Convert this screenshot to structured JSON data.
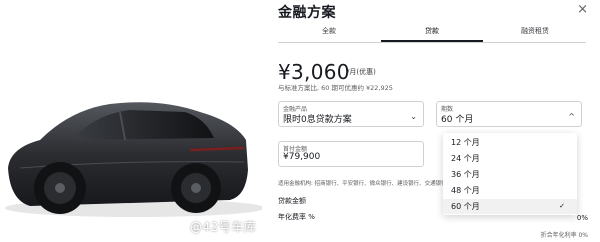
{
  "modal": {
    "title": "金融方案",
    "close_glyph": "×"
  },
  "tabs": [
    {
      "label": "全款",
      "active": false
    },
    {
      "label": "贷款",
      "active": true
    },
    {
      "label": "融资租赁",
      "active": false
    }
  ],
  "pricing": {
    "monthly_payment": "¥3,060",
    "unit": "/月(优惠)",
    "comparison": "与标准方案比, 60 期可优惠约 ¥22,925"
  },
  "fields": {
    "product": {
      "label": "金融产品",
      "value": "限时0息贷款方案"
    },
    "term": {
      "label": "期数",
      "value": "60 个月"
    },
    "down_payment": {
      "label": "首付金额",
      "value": "¥79,900"
    }
  },
  "term_options": [
    {
      "label": "12 个月",
      "selected": false
    },
    {
      "label": "24 个月",
      "selected": false
    },
    {
      "label": "36 个月",
      "selected": false
    },
    {
      "label": "48 个月",
      "selected": false
    },
    {
      "label": "60 个月",
      "selected": true
    }
  ],
  "banks_text": "适用金融机构: 招商银行、平安银行、微众银行、建设银行、交通银行",
  "loan_amount_label": "贷款金额",
  "annual_rate_label": "年化费率 %",
  "annual_rate_value": "0%",
  "footer_note": "折合年化利率 0%",
  "watermark": "@42号车库",
  "colors": {
    "text": "#171a20",
    "muted": "#5c5e62",
    "border": "#d0d1d2",
    "car": "#2b2d31"
  }
}
